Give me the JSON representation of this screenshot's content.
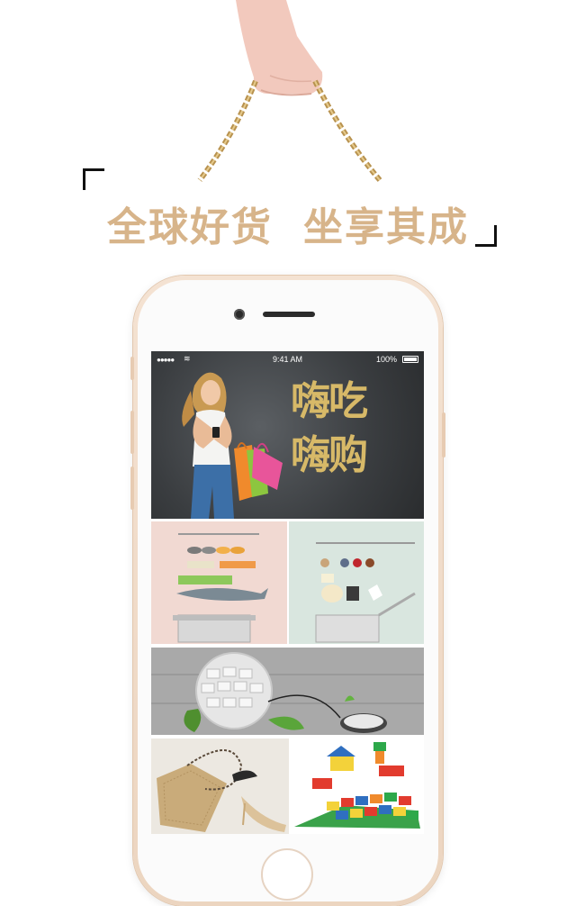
{
  "slogan": {
    "part1": "全球好货",
    "part2": "坐享其成"
  },
  "status_bar": {
    "signal": "●●●●●",
    "time": "9:41 AM",
    "battery": "100%"
  },
  "banner": {
    "line1": "嗨吃",
    "line2": "嗨购"
  },
  "tiles": [
    {
      "name": "food-ingredients-pink"
    },
    {
      "name": "food-ingredients-mint"
    },
    {
      "name": "electronics-keyboard-ball"
    },
    {
      "name": "fashion-bag-shoes"
    },
    {
      "name": "toys-building-blocks"
    }
  ],
  "colors": {
    "slogan": "#d7b48a",
    "banner_text": "#d7b968",
    "phone_frame": "#f1dccb"
  }
}
